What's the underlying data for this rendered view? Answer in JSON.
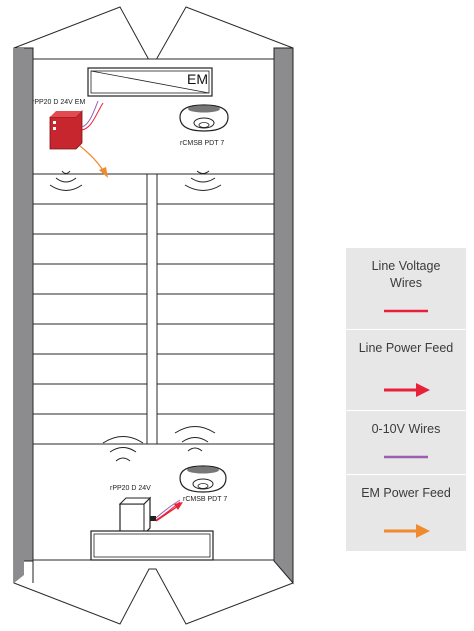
{
  "panels": {
    "top_label": "EM"
  },
  "devices": {
    "top_power_pack": "rPP20 D 24V EM",
    "top_sensor": "rCMSB PDT 7",
    "bottom_power_pack": "rPP20 D 24V",
    "bottom_sensor": "rCMSB PDT 7"
  },
  "legend": {
    "items": [
      {
        "label": "Line Voltage Wires",
        "swatch": "line",
        "color": "#e8203a"
      },
      {
        "label": "Line Power Feed",
        "swatch": "arrow",
        "color": "#e8203a"
      },
      {
        "label": "0-10V Wires",
        "swatch": "line",
        "color": "#9b5fb0"
      },
      {
        "label": "EM Power Feed",
        "swatch": "arrow",
        "color": "#f08a2e"
      }
    ]
  },
  "colors": {
    "line_voltage": "#e8203a",
    "ten_volt": "#9b5fb0",
    "em_feed": "#f08a2e",
    "device_red": "#c8262f",
    "wall_gray": "#8c8c8e"
  }
}
